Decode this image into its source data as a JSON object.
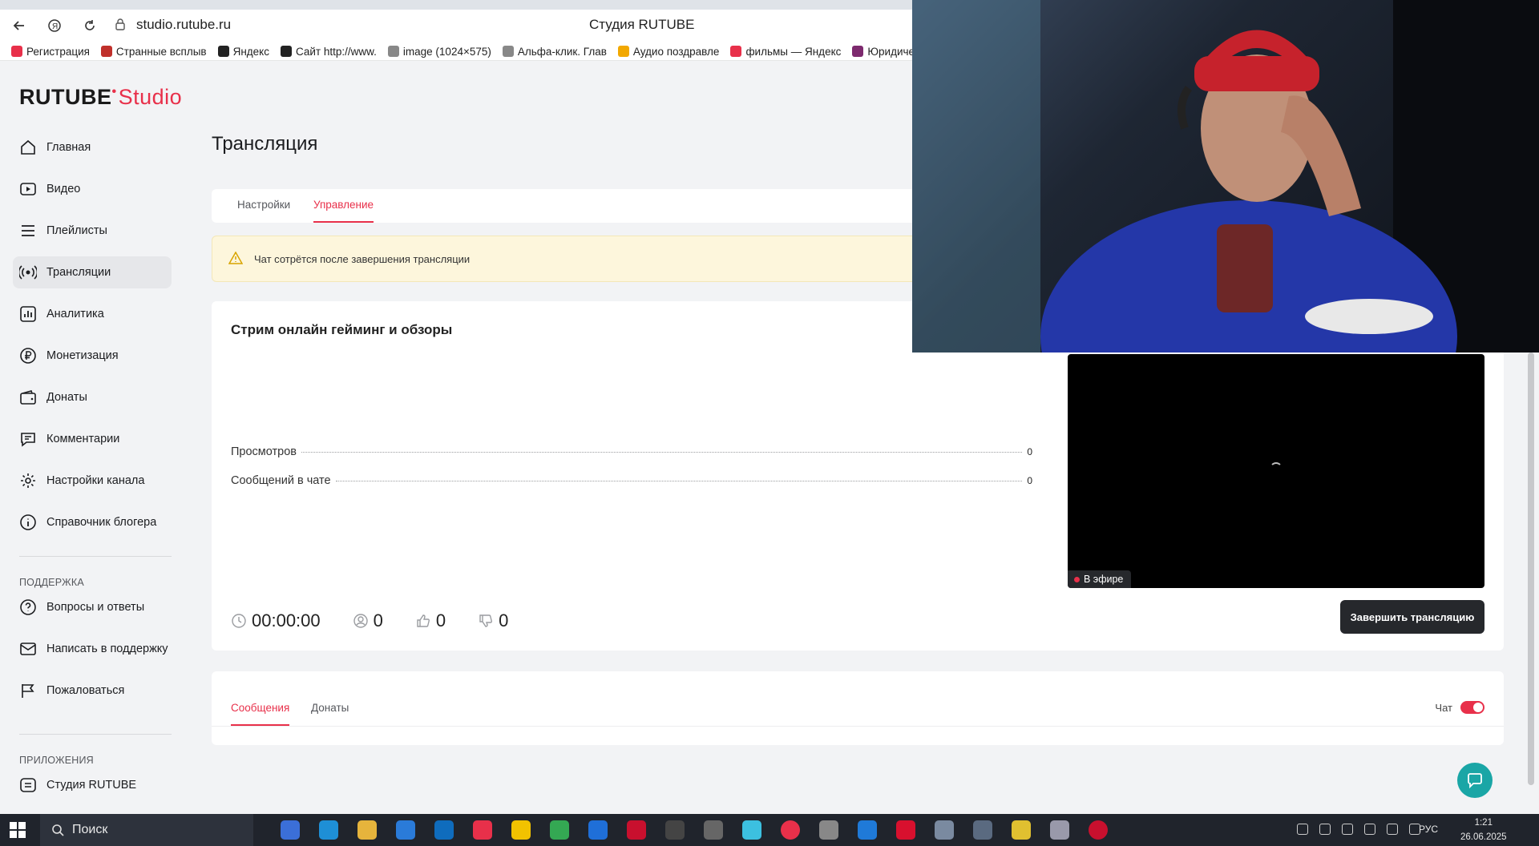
{
  "browser": {
    "url": "studio.rutube.ru",
    "window_title": "Студия RUTUBE",
    "bookmarks": [
      {
        "label": "Регистрация",
        "color": "#e8304a"
      },
      {
        "label": "Странные всплыв",
        "color": "#c0302b"
      },
      {
        "label": "Яндекс",
        "color": "#222"
      },
      {
        "label": "Сайт http://www.",
        "color": "#222"
      },
      {
        "label": "image (1024×575)",
        "color": "#888"
      },
      {
        "label": "Альфа-клик. Глав",
        "color": "#888"
      },
      {
        "label": "Аудио поздравле",
        "color": "#f2a800"
      },
      {
        "label": "фильмы — Яндекс",
        "color": "#e8304a"
      },
      {
        "label": "Юридически",
        "color": "#7d2a6e"
      }
    ]
  },
  "logo": {
    "main": "RUTUBE",
    "suffix": "Studio"
  },
  "sidebar": {
    "items": [
      {
        "label": "Главная",
        "icon": "home-icon"
      },
      {
        "label": "Видео",
        "icon": "video-icon"
      },
      {
        "label": "Плейлисты",
        "icon": "playlist-icon"
      },
      {
        "label": "Трансляции",
        "icon": "broadcast-icon",
        "active": true
      },
      {
        "label": "Аналитика",
        "icon": "analytics-icon"
      },
      {
        "label": "Монетизация",
        "icon": "ruble-icon"
      },
      {
        "label": "Донаты",
        "icon": "wallet-icon"
      },
      {
        "label": "Комментарии",
        "icon": "comment-icon"
      },
      {
        "label": "Настройки канала",
        "icon": "gear-icon"
      },
      {
        "label": "Справочник блогера",
        "icon": "info-icon"
      }
    ],
    "support_heading": "ПОДДЕРЖКА",
    "support_items": [
      {
        "label": "Вопросы и ответы",
        "icon": "question-icon"
      },
      {
        "label": "Написать в поддержку",
        "icon": "mail-icon"
      },
      {
        "label": "Пожаловаться",
        "icon": "flag-icon"
      }
    ],
    "apps_heading": "ПРИЛОЖЕНИЯ",
    "apps_items": [
      {
        "label": "Студия RUTUBE",
        "icon": "studio-icon"
      }
    ]
  },
  "page": {
    "title": "Трансляция",
    "tabs": [
      {
        "label": "Настройки",
        "active": false
      },
      {
        "label": "Управление",
        "active": true
      }
    ],
    "warning": "Чат сотрётся после завершения трансляции"
  },
  "stream": {
    "name": "Стрим онлайн гейминг и обзоры",
    "stats": [
      {
        "label": "Просмотров",
        "value": "0"
      },
      {
        "label": "Сообщений в чате",
        "value": "0"
      }
    ],
    "duration": "00:00:00",
    "viewers": "0",
    "likes": "0",
    "dislikes": "0",
    "live_badge": "В эфире",
    "stop_button": "Завершить трансляцию"
  },
  "chat": {
    "tabs": [
      {
        "label": "Сообщения",
        "active": true
      },
      {
        "label": "Донаты",
        "active": false
      }
    ],
    "toggle_label": "Чат",
    "toggle_on": true
  },
  "taskbar": {
    "search_placeholder": "Поиск",
    "lang": "РУС",
    "time": "1:21",
    "date": "26.06.2025"
  },
  "colors": {
    "accent": "#e8304a",
    "dark_button": "#26282c",
    "warning_bg": "#fdf6dc"
  }
}
